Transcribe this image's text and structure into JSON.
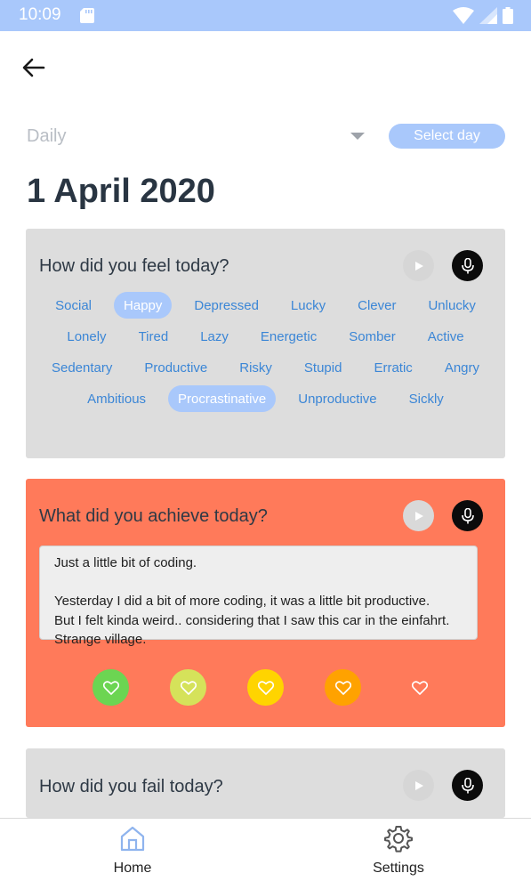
{
  "status_bar": {
    "time": "10:09"
  },
  "filter": {
    "period": "Daily",
    "select_day_label": "Select day"
  },
  "page_title": "1 April 2020",
  "cards": [
    {
      "question": "How did you feel today?",
      "moods": [
        {
          "label": "Social",
          "selected": false
        },
        {
          "label": "Happy",
          "selected": true
        },
        {
          "label": "Depressed",
          "selected": false
        },
        {
          "label": "Lucky",
          "selected": false
        },
        {
          "label": "Clever",
          "selected": false
        },
        {
          "label": "Unlucky",
          "selected": false
        },
        {
          "label": "Lonely",
          "selected": false
        },
        {
          "label": "Tired",
          "selected": false
        },
        {
          "label": "Lazy",
          "selected": false
        },
        {
          "label": "Energetic",
          "selected": false
        },
        {
          "label": "Somber",
          "selected": false
        },
        {
          "label": "Active",
          "selected": false
        },
        {
          "label": "Sedentary",
          "selected": false
        },
        {
          "label": "Productive",
          "selected": false
        },
        {
          "label": "Risky",
          "selected": false
        },
        {
          "label": "Stupid",
          "selected": false
        },
        {
          "label": "Erratic",
          "selected": false
        },
        {
          "label": "Angry",
          "selected": false
        },
        {
          "label": "Ambitious",
          "selected": false
        },
        {
          "label": "Procrastinative",
          "selected": true
        },
        {
          "label": "Unproductive",
          "selected": false
        },
        {
          "label": "Sickly",
          "selected": false
        }
      ]
    },
    {
      "question": "What did you achieve today?",
      "answer": "Just a little bit of coding.\n\nYesterday I did a bit of more coding, it was a little bit productive.\nBut I felt kinda weird.. considering that I saw this car in the einfahrt.\nStrange village.",
      "rating_colors": [
        "#6cd552",
        "#d5e25a",
        "#ffd400",
        "#ffa200",
        "#ff7a5a"
      ]
    },
    {
      "question": "How did you fail today?"
    }
  ],
  "colors": {
    "accent": "#a9c8fb",
    "mood_text": "#3b86d6",
    "achieve_card": "#ff7a5a",
    "neutral_card": "#dddddd"
  },
  "bottom_nav": [
    {
      "label": "Home",
      "icon": "home-icon",
      "active": true
    },
    {
      "label": "Settings",
      "icon": "gear-icon",
      "active": false
    }
  ]
}
